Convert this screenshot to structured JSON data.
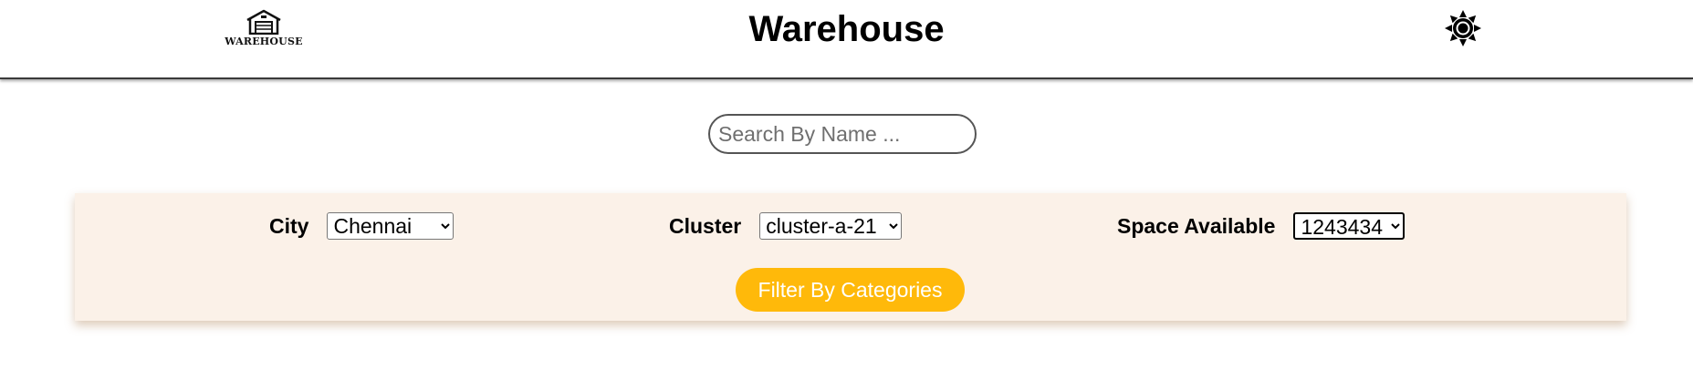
{
  "header": {
    "logo_text": "WAREHOUSE",
    "logo_icon": "warehouse-icon",
    "title": "Warehouse",
    "theme_icon": "sun-icon"
  },
  "search": {
    "placeholder": "Search By Name ...",
    "value": ""
  },
  "filters": {
    "city": {
      "label": "City",
      "selected": "Chennai"
    },
    "cluster": {
      "label": "Cluster",
      "selected": "cluster-a-21"
    },
    "space": {
      "label": "Space Available",
      "selected": "1243434"
    },
    "button_label": "Filter By Categories"
  },
  "colors": {
    "accent": "#ffb90a",
    "panel_background": "#fbf1e8",
    "text": "#000000"
  }
}
